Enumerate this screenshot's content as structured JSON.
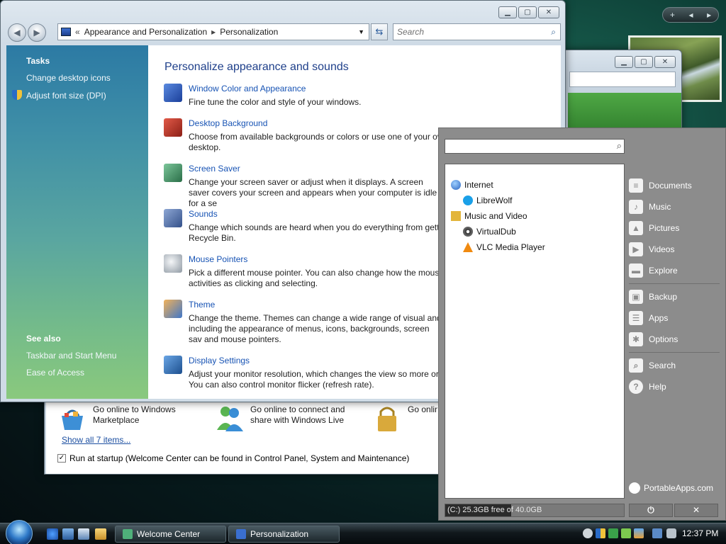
{
  "gadgets": {
    "add_symbol": "+",
    "prev_symbol": "◂",
    "next_symbol": "▸"
  },
  "welcome_window": {
    "items": [
      {
        "text": "Go online to Windows Marketplace",
        "icon": "marketplace-basket-icon"
      },
      {
        "text": "Go online to connect and share with Windows Live",
        "icon": "windows-live-icon"
      },
      {
        "text": "Go online to help",
        "icon": "padlock-icon"
      }
    ],
    "show_all": "Show all 7 items...",
    "startup_label": "Run at startup (Welcome Center can be found in Control Panel, System and Maintenance)",
    "startup_checked": true
  },
  "personalization": {
    "breadcrumb": [
      "Appearance and Personalization",
      "Personalization"
    ],
    "search_placeholder": "Search",
    "tasks_title": "Tasks",
    "tasks": [
      "Change desktop icons",
      "Adjust font size (DPI)"
    ],
    "see_also_title": "See also",
    "see_also": [
      "Taskbar and Start Menu",
      "Ease of Access"
    ],
    "heading": "Personalize appearance and sounds",
    "items": [
      {
        "title": "Window Color and Appearance",
        "desc": "Fine tune the color and style of your windows.",
        "color": "#3a6fd0"
      },
      {
        "title": "Desktop Background",
        "desc": "Choose from available backgrounds or colors or use one of your ov desktop.",
        "color": "#c0392b"
      },
      {
        "title": "Screen Saver",
        "desc": "Change your screen saver or adjust when it displays. A screen saver covers your screen and appears when your computer is idle for a se",
        "color": "#4a9a6a"
      },
      {
        "title": "Sounds",
        "desc": "Change which sounds are heard when you do everything from gett Recycle Bin.",
        "color": "#5577aa"
      },
      {
        "title": "Mouse Pointers",
        "desc": "Pick a different mouse pointer. You can also change how the mous activities as clicking and selecting.",
        "color": "#9aa3ab"
      },
      {
        "title": "Theme",
        "desc": "Change the theme. Themes can change a wide range of visual and including the appearance of menus, icons, backgrounds, screen sav and mouse pointers.",
        "color": "#e08a2a"
      },
      {
        "title": "Display Settings",
        "desc": "Adjust your monitor resolution, which changes the view so more or You can also control monitor flicker (refresh rate).",
        "color": "#2f6fb0"
      }
    ]
  },
  "portableapps": {
    "tree": [
      {
        "label": "Internet",
        "level": 0,
        "icon": "globe-icon",
        "color": "#3c77c9"
      },
      {
        "label": "LibreWolf",
        "level": 1,
        "icon": "librewolf-icon",
        "color": "#1aa0e8"
      },
      {
        "label": "Music and Video",
        "level": 0,
        "icon": "folder-music-icon",
        "color": "#e3b53b"
      },
      {
        "label": "VirtualDub",
        "level": 1,
        "icon": "virtualdub-icon",
        "color": "#555555"
      },
      {
        "label": "VLC Media Player",
        "level": 1,
        "icon": "vlc-icon",
        "color": "#f08a10"
      }
    ],
    "links_group1": [
      {
        "label": "Documents",
        "glyph": "≡"
      },
      {
        "label": "Music",
        "glyph": "♪"
      },
      {
        "label": "Pictures",
        "glyph": "▲"
      },
      {
        "label": "Videos",
        "glyph": "▶"
      },
      {
        "label": "Explore",
        "glyph": "▬"
      }
    ],
    "links_group2": [
      {
        "label": "Backup",
        "glyph": "▣"
      },
      {
        "label": "Apps",
        "glyph": "☰"
      },
      {
        "label": "Options",
        "glyph": "✱"
      }
    ],
    "links_group3": [
      {
        "label": "Search",
        "glyph": "⌕"
      },
      {
        "label": "Help",
        "glyph": "?"
      }
    ],
    "brand": "PortableApps.com",
    "disk_status": "(C:) 25.3GB free of 40.0GB",
    "disk_used_fraction": 0.37,
    "power_glyph": "⏻",
    "close_glyph": "✕"
  },
  "taskbar": {
    "buttons": [
      {
        "label": "Welcome Center",
        "color": "#4fb07a"
      },
      {
        "label": "Personalization",
        "color": "#3a6fd0"
      }
    ],
    "clock": "12:37 PM"
  }
}
